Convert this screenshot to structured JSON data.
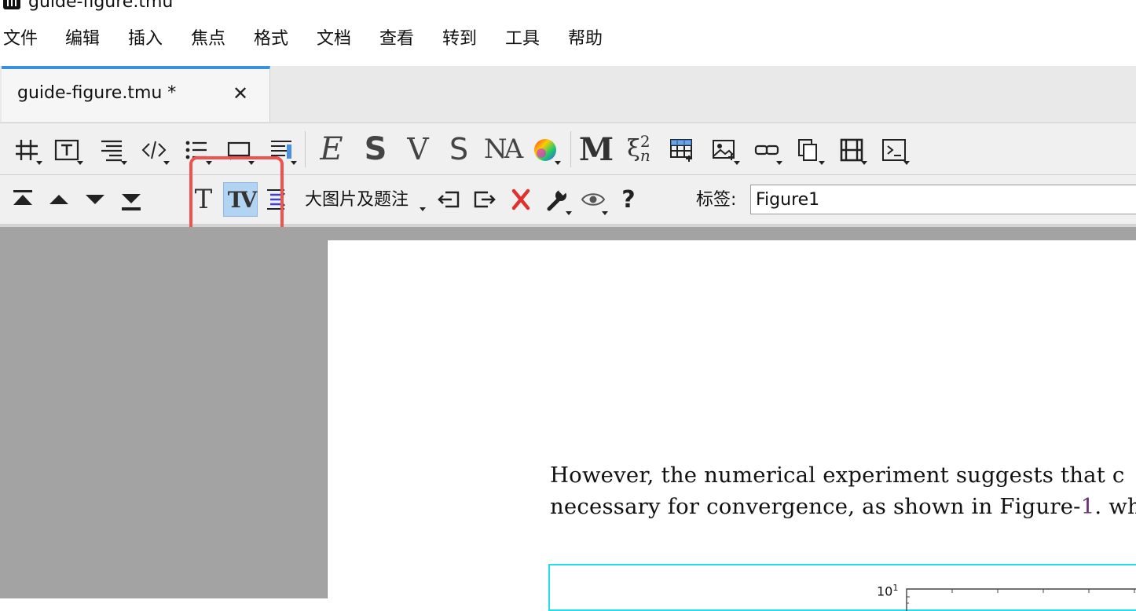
{
  "window": {
    "title": "guide-figure.tmu"
  },
  "menu": [
    "文件",
    "编辑",
    "插入",
    "焦点",
    "格式",
    "文档",
    "查看",
    "转到",
    "工具",
    "帮助"
  ],
  "tabs": [
    {
      "label": "guide-figure.tmu *",
      "active": true
    }
  ],
  "toolbar1": {
    "icons": [
      "table-icon",
      "text-field-icon",
      "align-icon",
      "source-code-icon",
      "list-icon",
      "speech-bubble-icon",
      "section-list-icon",
      "emphasis-E-icon",
      "sans-S-icon",
      "V-icon",
      "S-icon",
      "NA-icon",
      "color-wheel-icon",
      "M-icon",
      "xi-subscript-icon",
      "grid-plus-icon",
      "image-plus-icon",
      "link-icon",
      "copy-icon",
      "film-icon",
      "terminal-icon"
    ],
    "emphasis_E": "E",
    "sans_S": "S",
    "V": "V",
    "S": "S",
    "NA": "NA",
    "M": "M",
    "xi_label": "ξ",
    "xi_sup": "2",
    "xi_sub": "n"
  },
  "toolbar2": {
    "icons": [
      "move-top-icon",
      "move-up-icon",
      "move-down-icon",
      "move-bottom-icon",
      "text-T-icon",
      "text-TV-icon",
      "text-stack-icon",
      "arrow-left-box-icon",
      "arrow-right-box-icon",
      "delete-x-icon",
      "wrench-icon",
      "eye-icon",
      "help-icon"
    ],
    "t_label": "T",
    "tv_label": "TV",
    "help_label": "?",
    "figure_mode_label": "大图片及题注",
    "tag_label": "标签:",
    "tag_value": "Figure1"
  },
  "document": {
    "line1": "However, the numerical experiment suggests that c",
    "line2_pre": "necessary for convergence, as shown in Figure-",
    "line2_ref": "1",
    "line2_post": ". wh",
    "plot_ytick_base": "10",
    "plot_ytick_exp": "1"
  },
  "colors": {
    "tab_accent": "#3c8fdb",
    "highlight": "#ef5350",
    "figure_border": "#22e0e8",
    "ref_link": "#6a2c78",
    "delete_red": "#e03030"
  }
}
